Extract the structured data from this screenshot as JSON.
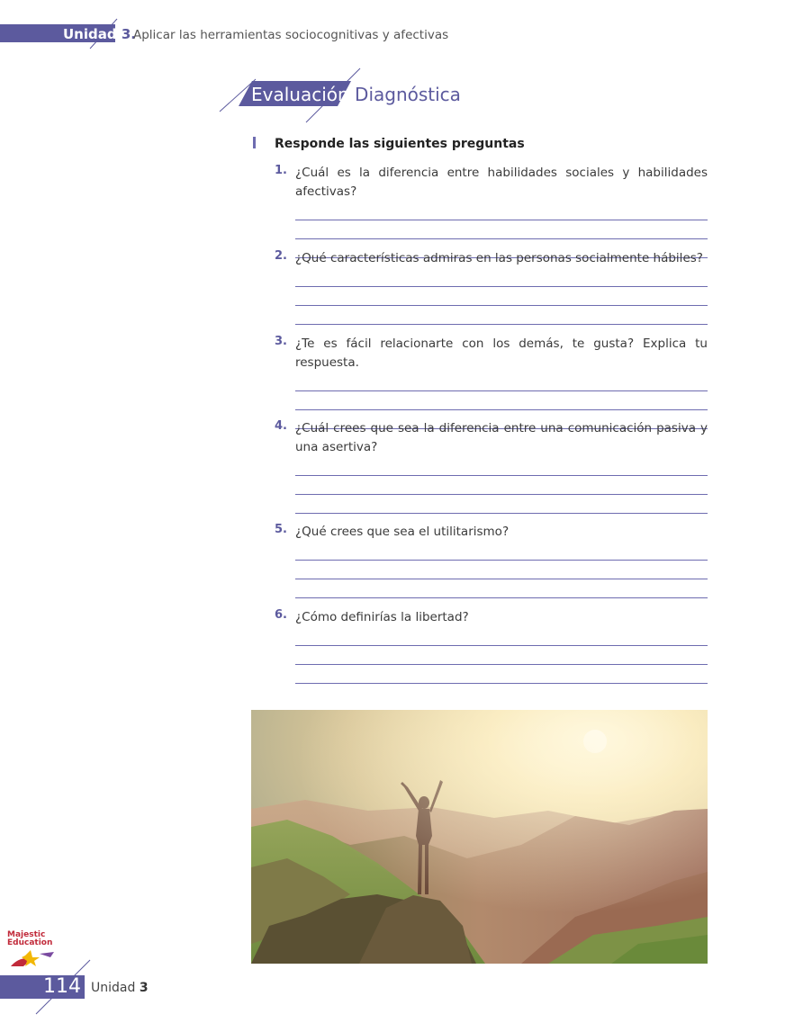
{
  "header": {
    "unit_label": "Unidad",
    "unit_number": "3.",
    "subtitle": "Aplicar las herramientas sociocognitivas y afectivas"
  },
  "section": {
    "title_part1": "Evaluación",
    "title_part2": "Diagnóstica"
  },
  "instruction": "Responde las siguientes preguntas",
  "questions": [
    {
      "number": "1.",
      "text": "¿Cuál es la diferencia entre habilidades sociales y habilidades afectivas?"
    },
    {
      "number": "2.",
      "text": "¿Qué características admiras en las personas socialmente hábiles?"
    },
    {
      "number": "3.",
      "text": "¿Te es fácil relacionarte con los demás, te gusta? Explica tu respuesta."
    },
    {
      "number": "4.",
      "text": "¿Cuál crees que sea la diferencia entre una comunicación pasiva y una asertiva?"
    },
    {
      "number": "5.",
      "text": "¿Qué crees que sea el utilitarismo?"
    },
    {
      "number": "6.",
      "text": "¿Cómo definirías la libertad?"
    }
  ],
  "logo": {
    "line1": "Majestic",
    "line2": "Education"
  },
  "footer": {
    "page_number": "114",
    "unit_label": "Unidad",
    "unit_number": "3"
  },
  "colors": {
    "accent": "#5c5a9e",
    "answer_line": "#6e6cb0"
  }
}
